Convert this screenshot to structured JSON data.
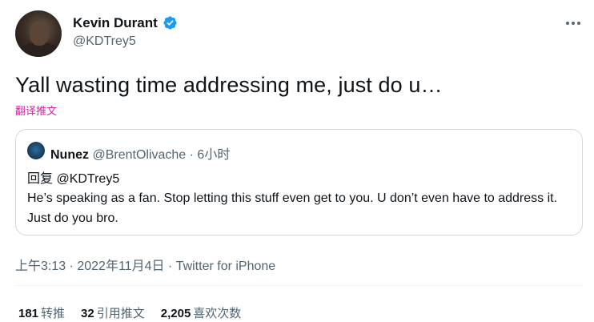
{
  "author": {
    "name": "Kevin Durant",
    "handle": "@KDTrey5"
  },
  "tweet": {
    "text": "Yall wasting time addressing me, just do u…",
    "translate_label": "翻译推文",
    "timestamp": "上午3:13 · 2022年11月4日 · Twitter for iPhone"
  },
  "quote": {
    "name": "Nunez",
    "handle": "@BrentOlivache",
    "time": "· 6小时",
    "reply_to": "回复 @KDTrey5",
    "text": "He’s speaking as a fan. Stop letting this stuff even get to you. U don’t even have to address it. Just do you bro."
  },
  "stats": [
    {
      "count": "181",
      "label": "转推"
    },
    {
      "count": "32",
      "label": "引用推文"
    },
    {
      "count": "2,205",
      "label": "喜欢次数"
    }
  ],
  "colors": {
    "verified": "#1d9bf0",
    "translate_link": "#d6249f",
    "secondary_text": "#536471"
  },
  "icons": {
    "verified": "verified-badge-icon",
    "more": "more-horizontal-icon"
  }
}
